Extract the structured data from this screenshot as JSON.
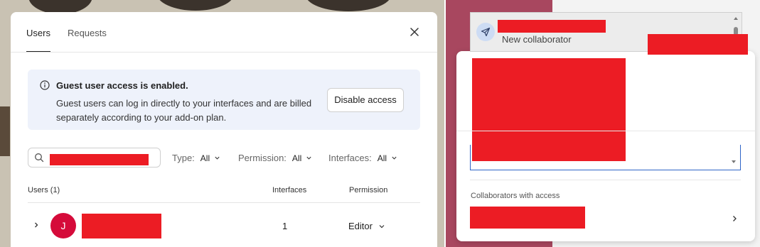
{
  "dialog": {
    "tabs": [
      {
        "label": "Users",
        "active": true
      },
      {
        "label": "Requests",
        "active": false
      }
    ],
    "banner": {
      "title": "Guest user access is enabled.",
      "text": "Guest users can log in directly to your interfaces and are billed separately according to your add-on plan.",
      "button_label": "Disable access"
    },
    "filters": [
      {
        "label": "Type:",
        "value": "All"
      },
      {
        "label": "Permission:",
        "value": "All"
      },
      {
        "label": "Interfaces:",
        "value": "All"
      }
    ],
    "table": {
      "headers": {
        "users": "Users (1)",
        "interfaces": "Interfaces",
        "permission": "Permission"
      },
      "rows": [
        {
          "avatar_initial": "J",
          "interfaces": "1",
          "permission": "Editor"
        }
      ]
    }
  },
  "share_panel": {
    "suggestion_label": "New collaborator",
    "section_label": "Collaborators with access"
  },
  "colors": {
    "avatar": "#d50b3a",
    "banner_bg": "#eef2fb",
    "focus_border": "#2f64c7",
    "redaction": "#ec1c24"
  },
  "icons": [
    "info-icon",
    "search-icon",
    "close-icon",
    "chevron-down-icon",
    "chevron-right-icon",
    "send-icon"
  ]
}
